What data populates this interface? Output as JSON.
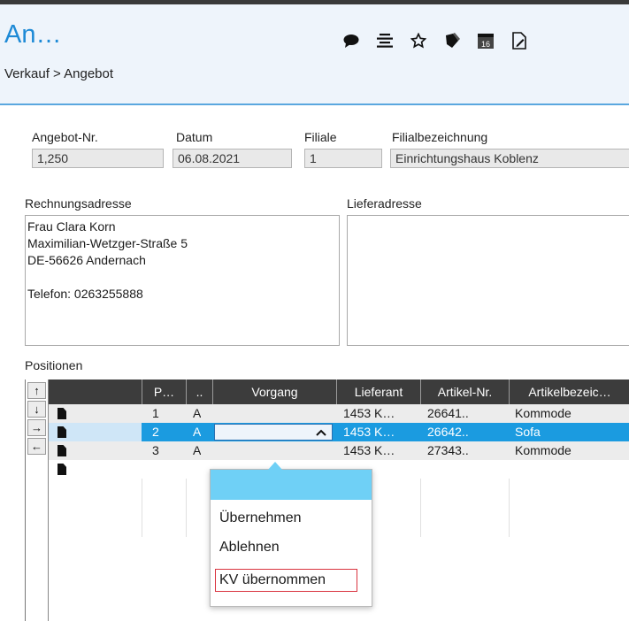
{
  "window": {
    "title": "An…"
  },
  "breadcrumb": "Verkauf > Angebot",
  "toolbar": {
    "icons": [
      "comment-icon",
      "list-icon",
      "star-icon",
      "tag-icon",
      "calendar-icon",
      "edit-icon"
    ],
    "calendar_day": "16"
  },
  "header_fields": {
    "offer_no_label": "Angebot-Nr.",
    "offer_no": "1,250",
    "date_label": "Datum",
    "date": "06.08.2021",
    "branch_label": "Filiale",
    "branch": "1",
    "branch_name_label": "Filialbezeichnung",
    "branch_name": "Einrichtungshaus Koblenz"
  },
  "billing": {
    "label": "Rechnungsadresse",
    "lines": [
      "Frau Clara Korn",
      "Maximilian-Wetzger-Straße 5",
      "DE-56626 Andernach",
      "",
      "Telefon: 0263255888"
    ]
  },
  "delivery": {
    "label": "Lieferadresse"
  },
  "positions": {
    "label": "Positionen",
    "columns": [
      "P…",
      "..",
      "Vorgang",
      "Lieferant",
      "Artikel-Nr.",
      "Artikelbezeic…"
    ],
    "rows": [
      {
        "pos": "1",
        "status": "A",
        "process": "",
        "supplier": "1453 K…",
        "article_no": "26641..",
        "article_name": "Kommode"
      },
      {
        "pos": "2",
        "status": "A",
        "process": "",
        "supplier": "1453 K…",
        "article_no": "26642..",
        "article_name": "Sofa"
      },
      {
        "pos": "3",
        "status": "A",
        "process": "",
        "supplier": "1453 K…",
        "article_no": "27343..",
        "article_name": "Kommode"
      }
    ],
    "selected_row": 2
  },
  "nav_buttons": [
    "↑",
    "↓",
    "→",
    "←"
  ],
  "process_dropdown": {
    "options": [
      "",
      "Übernehmen",
      "Ablehnen",
      "KV übernommen"
    ],
    "highlighted_index": 0,
    "marked_option": "KV übernommen"
  },
  "colors": {
    "title": "#1e8ad6",
    "header_bg": "#eef4fb",
    "accent_line": "#5aa7df",
    "grid_header": "#3c3c3c",
    "selected_row": "#1b9be0",
    "dropdown_highlight": "#6fd0f6",
    "mark_red": "#d9333f"
  }
}
